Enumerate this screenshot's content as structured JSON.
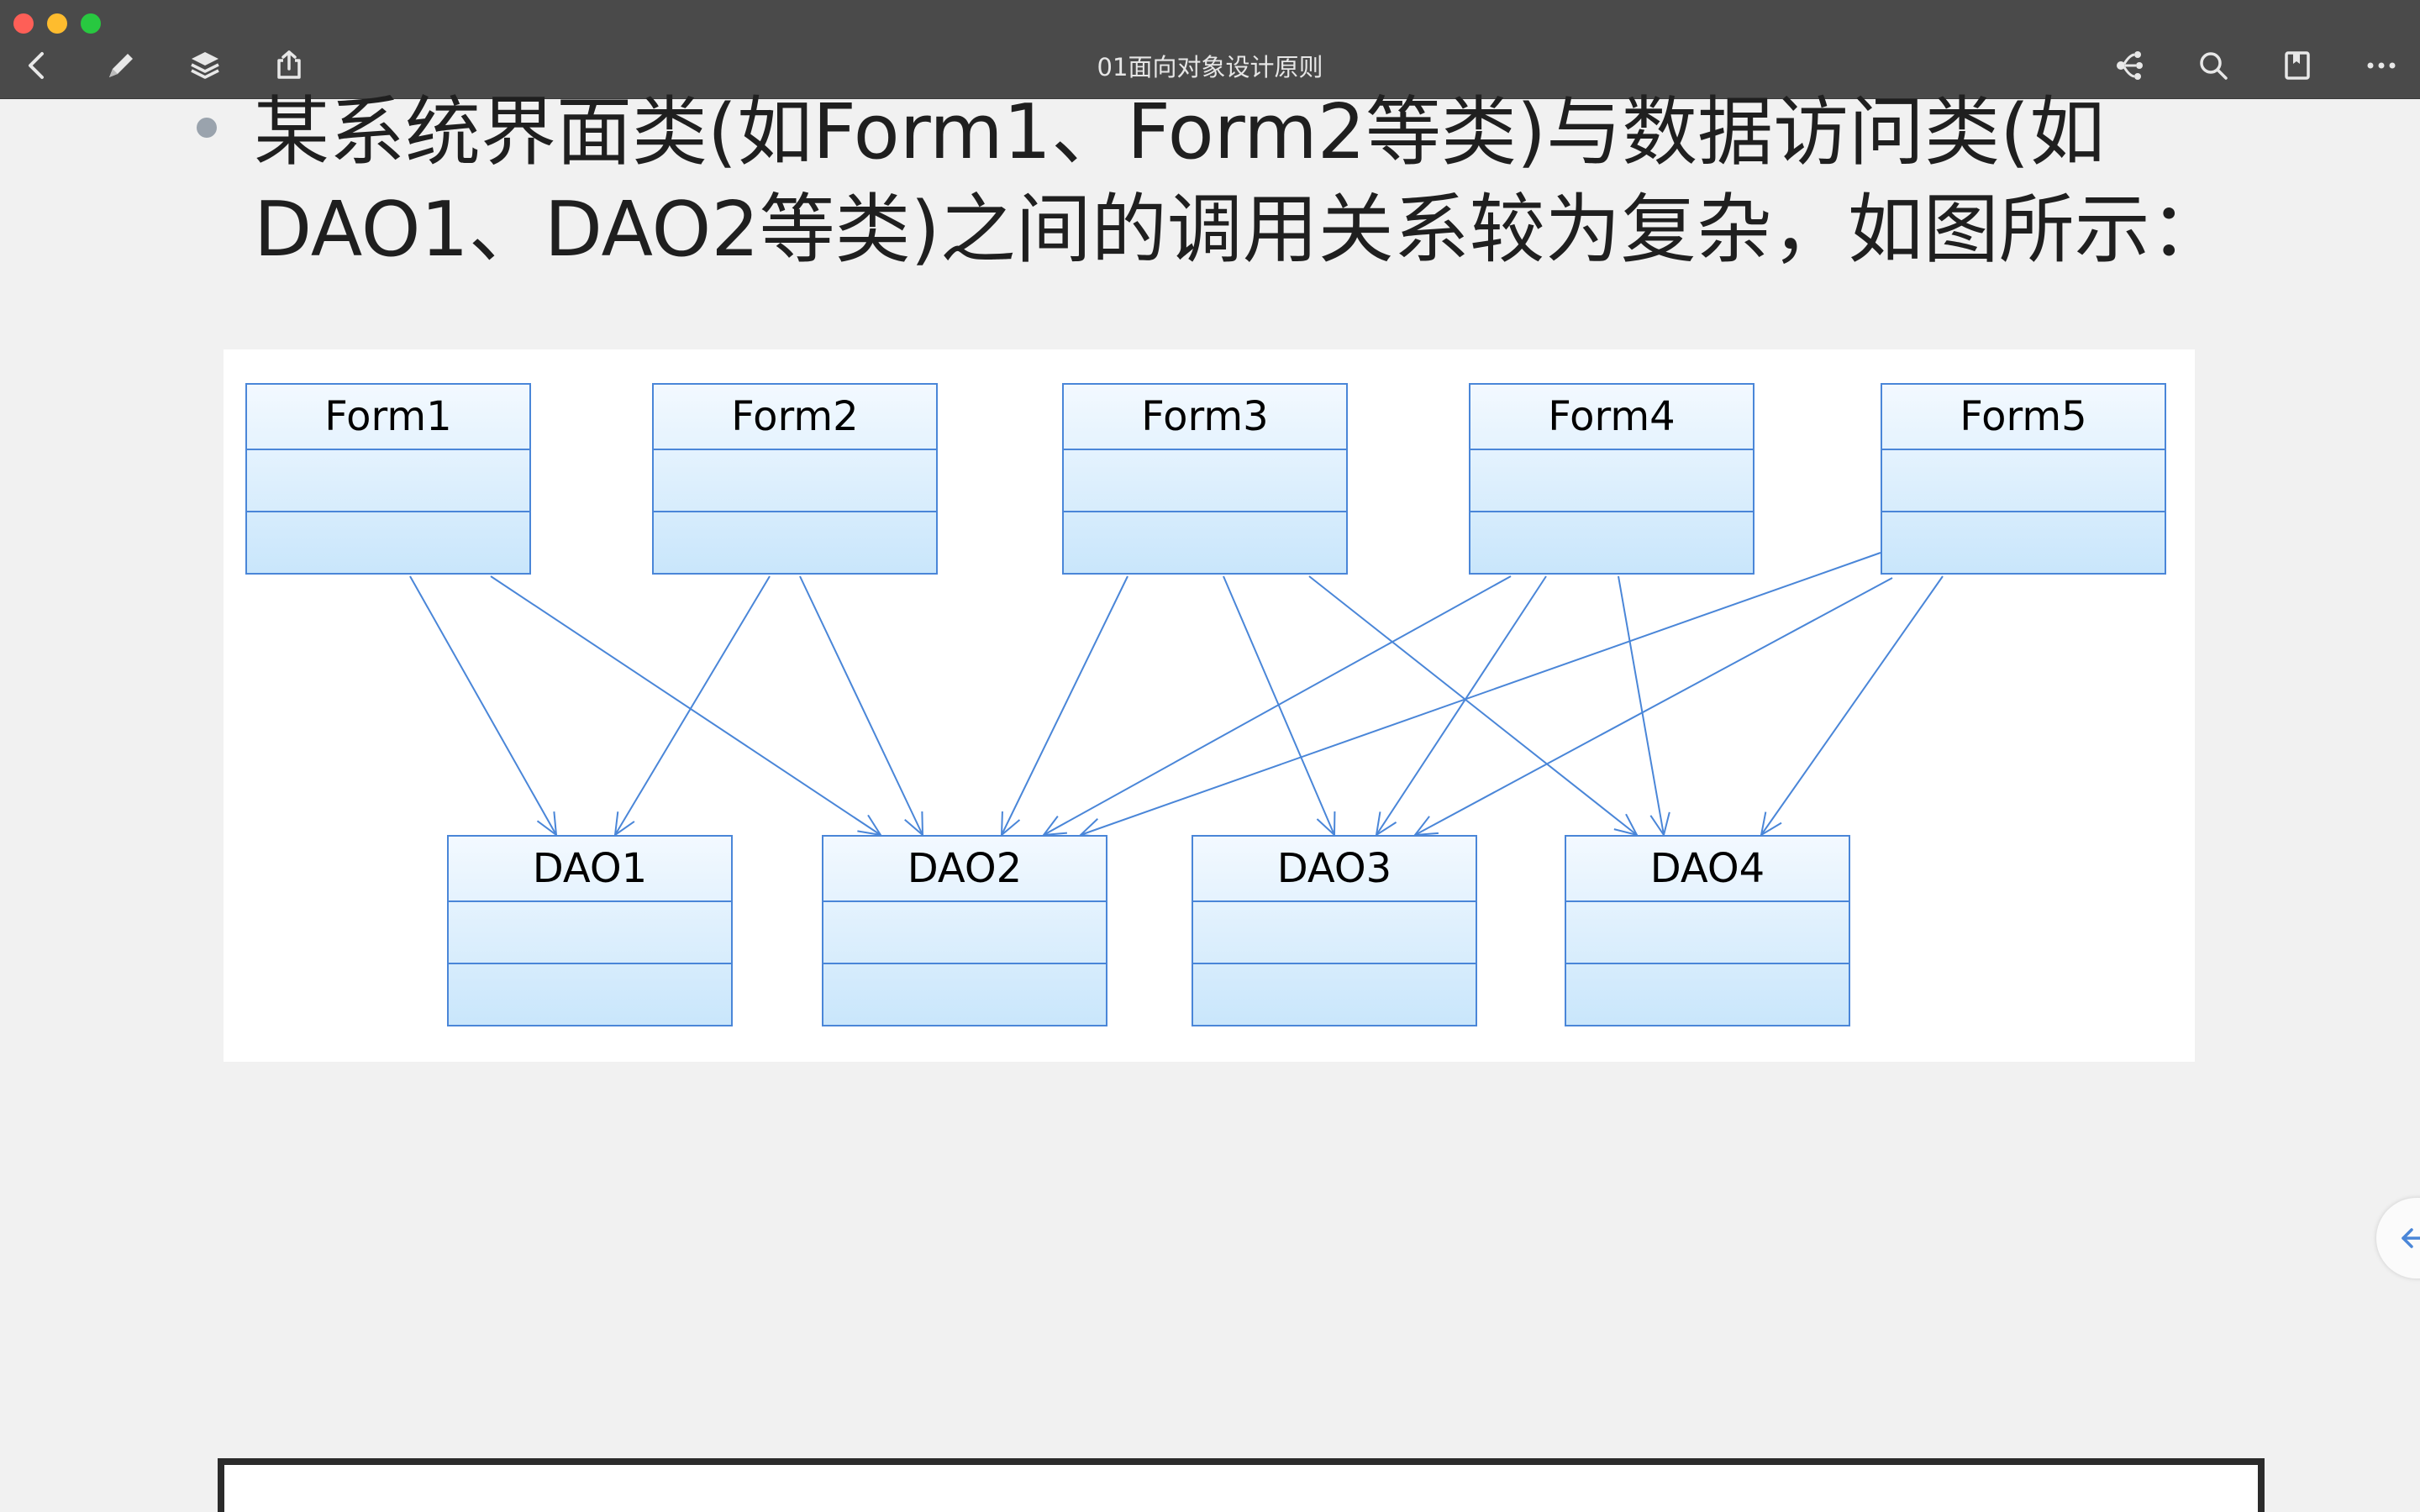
{
  "window": {
    "title": "01面向对象设计原则"
  },
  "toolbar": {
    "left_icons": [
      "back-icon",
      "pencil-icon",
      "layers-icon",
      "share-icon"
    ],
    "right_icons": [
      "mind-map-icon",
      "search-icon",
      "bookmark-icon",
      "more-icon"
    ]
  },
  "slide": {
    "text": "某系统界面类(如Form1、Form2等类)与数据访问类(如\nDAO1、DAO2等类)之间的调用关系较为复杂，如图所示："
  },
  "diagram": {
    "forms": [
      "Form1",
      "Form2",
      "Form3",
      "Form4",
      "Form5"
    ],
    "daos": [
      "DAO1",
      "DAO2",
      "DAO3",
      "DAO4"
    ],
    "dependencies": [
      [
        "Form1",
        "DAO1"
      ],
      [
        "Form1",
        "DAO2"
      ],
      [
        "Form2",
        "DAO1"
      ],
      [
        "Form2",
        "DAO2"
      ],
      [
        "Form3",
        "DAO2"
      ],
      [
        "Form3",
        "DAO3"
      ],
      [
        "Form3",
        "DAO4"
      ],
      [
        "Form4",
        "DAO2"
      ],
      [
        "Form4",
        "DAO3"
      ],
      [
        "Form4",
        "DAO4"
      ],
      [
        "Form5",
        "DAO2"
      ],
      [
        "Form5",
        "DAO3"
      ],
      [
        "Form5",
        "DAO4"
      ]
    ],
    "colors": {
      "border": "#4a86d8",
      "fill_top": "#f3f9ff",
      "fill_bottom": "#c9e6fb",
      "arrow": "#4a86d8"
    }
  },
  "side_tab": {
    "icon": "arrow-left-icon"
  }
}
